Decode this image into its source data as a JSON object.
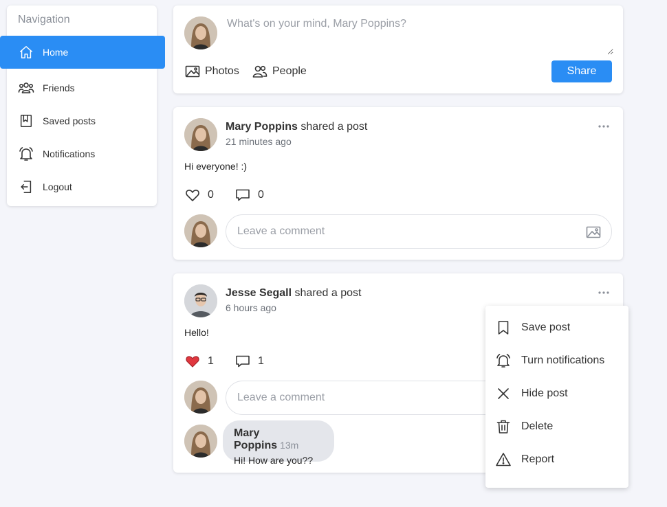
{
  "sidebar": {
    "title": "Navigation",
    "items": [
      {
        "label": "Home",
        "icon": "home-icon"
      },
      {
        "label": "Friends",
        "icon": "friends-icon"
      },
      {
        "label": "Saved posts",
        "icon": "bookmark-icon"
      },
      {
        "label": "Notifications",
        "icon": "bell-icon"
      },
      {
        "label": "Logout",
        "icon": "logout-icon"
      }
    ]
  },
  "composer": {
    "placeholder": "What's on your mind, Mary Poppins?",
    "photos_label": "Photos",
    "people_label": "People",
    "share_label": "Share"
  },
  "posts": [
    {
      "author": "Mary Poppins",
      "action": " shared a post",
      "time": "21 minutes ago",
      "text": "Hi everyone! :)",
      "likes": "0",
      "comments": "0",
      "liked": false,
      "comment_placeholder": "Leave a comment"
    },
    {
      "author": "Jesse Segall",
      "action": " shared a post",
      "time": "6 hours ago",
      "text": "Hello!",
      "likes": "1",
      "comments": "1",
      "liked": true,
      "comment_placeholder": "Leave a comment",
      "reply": {
        "author": "Mary Poppins",
        "ago": "13m",
        "text": "Hi! How are you??"
      }
    }
  ],
  "post_menu": {
    "items": [
      {
        "label": "Save post",
        "icon": "bookmark-icon"
      },
      {
        "label": "Turn notifications",
        "icon": "bell-icon"
      },
      {
        "label": "Hide post",
        "icon": "close-icon"
      },
      {
        "label": "Delete",
        "icon": "trash-icon"
      },
      {
        "label": "Report",
        "icon": "warning-icon"
      }
    ]
  },
  "colors": {
    "accent": "#2a8df4",
    "background": "#f4f5fa",
    "like": "#e0373f"
  }
}
